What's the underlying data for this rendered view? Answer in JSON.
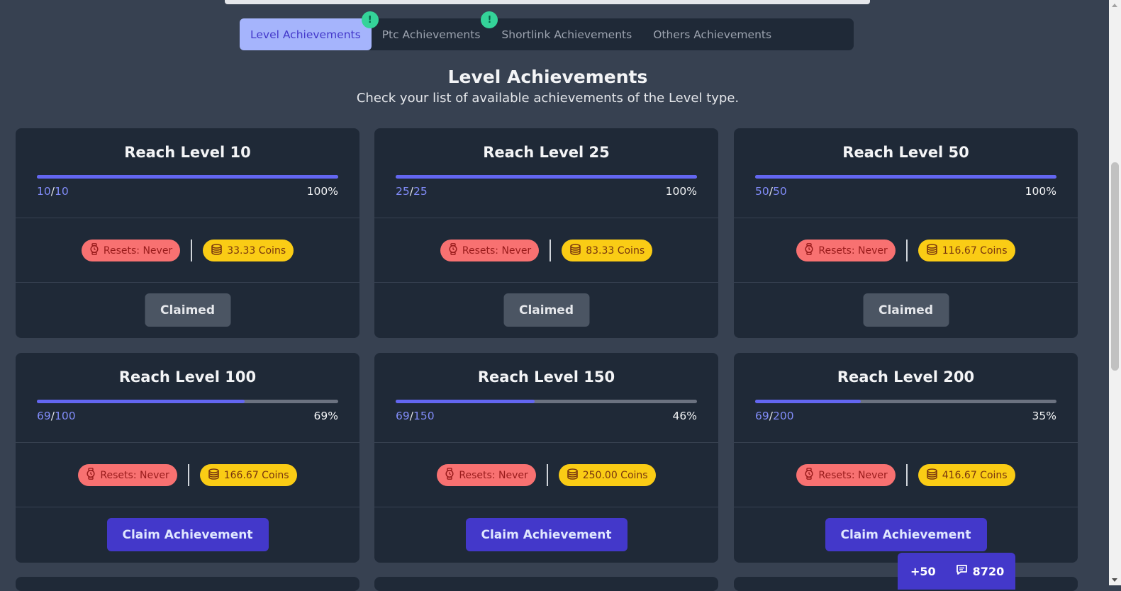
{
  "tabs": [
    {
      "label": "Level Achievements",
      "active": true,
      "badge": "!"
    },
    {
      "label": "Ptc Achievements",
      "active": false,
      "badge": "!"
    },
    {
      "label": "Shortlink Achievements",
      "active": false,
      "badge": ""
    },
    {
      "label": "Others Achievements",
      "active": false,
      "badge": ""
    }
  ],
  "heading": {
    "title": "Level Achievements",
    "subtitle": "Check your list of available achievements of the Level type."
  },
  "cards": [
    {
      "title": "Reach Level 10",
      "current": "10",
      "target": "10",
      "percent": "100%",
      "fill": 1.0,
      "resets": "Resets: Never",
      "reward": "33.33 Coins",
      "button": "Claimed",
      "claimed": true
    },
    {
      "title": "Reach Level 25",
      "current": "25",
      "target": "25",
      "percent": "100%",
      "fill": 1.0,
      "resets": "Resets: Never",
      "reward": "83.33 Coins",
      "button": "Claimed",
      "claimed": true
    },
    {
      "title": "Reach Level 50",
      "current": "50",
      "target": "50",
      "percent": "100%",
      "fill": 1.0,
      "resets": "Resets: Never",
      "reward": "116.67 Coins",
      "button": "Claimed",
      "claimed": true
    },
    {
      "title": "Reach Level 100",
      "current": "69",
      "target": "100",
      "percent": "69%",
      "fill": 0.69,
      "resets": "Resets: Never",
      "reward": "166.67 Coins",
      "button": "Claim Achievement",
      "claimed": false
    },
    {
      "title": "Reach Level 150",
      "current": "69",
      "target": "150",
      "percent": "46%",
      "fill": 0.46,
      "resets": "Resets: Never",
      "reward": "250.00 Coins",
      "button": "Claim Achievement",
      "claimed": false
    },
    {
      "title": "Reach Level 200",
      "current": "69",
      "target": "200",
      "percent": "35%",
      "fill": 0.35,
      "resets": "Resets: Never",
      "reward": "416.67 Coins",
      "button": "Claim Achievement",
      "claimed": false
    }
  ],
  "chat": {
    "bonus": "+50",
    "count": "8720"
  },
  "icons": {
    "resets": "watch-icon",
    "reward": "coins-icon",
    "chat": "chat-icon"
  },
  "colors": {
    "accent": "#6366f1",
    "reset_pill": "#f87171",
    "coin_pill": "#facc15",
    "badge": "#34d399"
  }
}
